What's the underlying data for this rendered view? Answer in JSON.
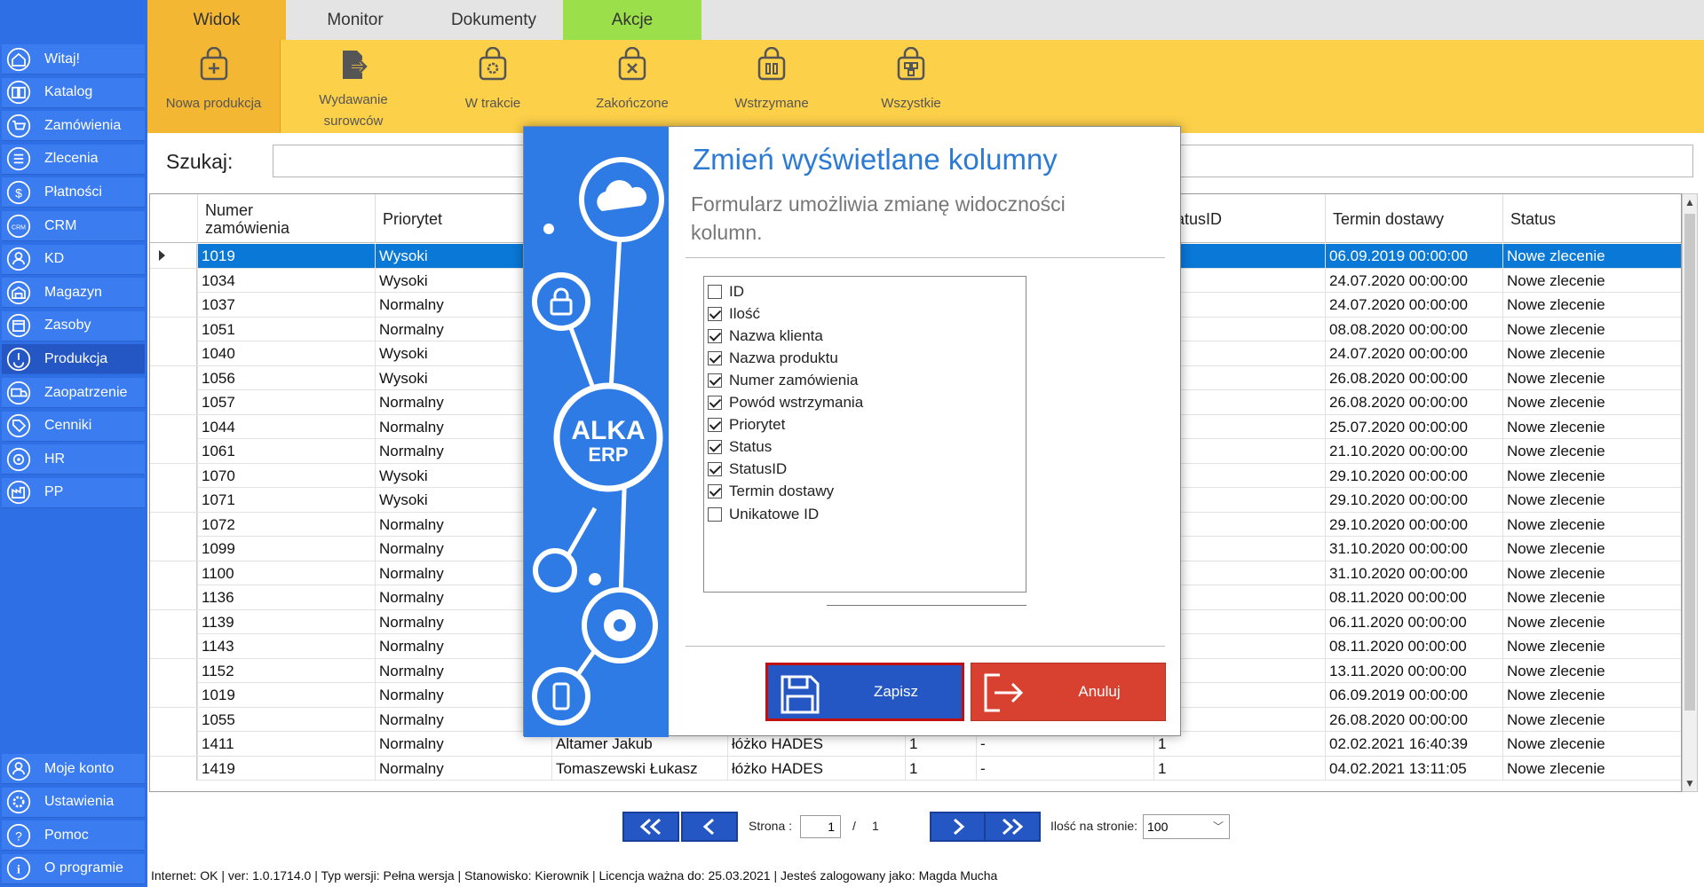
{
  "colors": {
    "sidebar": "#2f6fe6",
    "ribbon": "#fdd04a",
    "ribbon_selected": "#f4b733",
    "tab_akcje": "#9be04a",
    "tab_widok": "#f4b733",
    "selected_row": "#0a78d7",
    "save": "#2456c4",
    "cancel": "#d8412f"
  },
  "sidebar": {
    "items": [
      {
        "label": "Witaj!",
        "icon": "home-icon"
      },
      {
        "label": "Katalog",
        "icon": "book-icon"
      },
      {
        "label": "Zamówienia",
        "icon": "cart-icon"
      },
      {
        "label": "Zlecenia",
        "icon": "list-icon"
      },
      {
        "label": "Płatności",
        "icon": "dollar-icon"
      },
      {
        "label": "CRM",
        "icon": "crm-icon"
      },
      {
        "label": "KD",
        "icon": "person-icon"
      },
      {
        "label": "Magazyn",
        "icon": "warehouse-icon"
      },
      {
        "label": "Zasoby",
        "icon": "calendar-icon"
      },
      {
        "label": "Produkcja",
        "icon": "production-icon"
      },
      {
        "label": "Zaopatrzenie",
        "icon": "truck-icon"
      },
      {
        "label": "Cenniki",
        "icon": "tag-icon"
      },
      {
        "label": "HR",
        "icon": "hr-icon"
      },
      {
        "label": "PP",
        "icon": "factory-icon"
      }
    ],
    "bottom": [
      {
        "label": "Moje konto",
        "icon": "user-icon"
      },
      {
        "label": "Ustawienia",
        "icon": "gear-icon"
      },
      {
        "label": "Pomoc",
        "icon": "help-icon"
      },
      {
        "label": "O programie",
        "icon": "info-icon"
      }
    ]
  },
  "tabs": [
    {
      "label": "Widok"
    },
    {
      "label": "Monitor"
    },
    {
      "label": "Dokumenty"
    },
    {
      "label": "Akcje"
    }
  ],
  "ribbon": {
    "buttons": [
      {
        "label": "Nowa produkcja"
      },
      {
        "label": "Wydawanie",
        "label2": "surowców"
      },
      {
        "label": "W trakcie"
      },
      {
        "label": "Zakończone"
      },
      {
        "label": "Wstrzymane"
      },
      {
        "label": "Wszystkie"
      }
    ]
  },
  "search": {
    "label": "Szukaj:",
    "value": ""
  },
  "grid": {
    "headers": {
      "numer1": "Numer",
      "numer2": "zamówienia",
      "priorytet": "Priorytet",
      "statusid": "atusID",
      "termin": "Termin dostawy",
      "status": "Status"
    },
    "rows": [
      {
        "numer": "1019",
        "priorytet": "Wysoki",
        "termin": "06.09.2019 00:00:00",
        "status": "Nowe zlecenie"
      },
      {
        "numer": "1034",
        "priorytet": "Wysoki",
        "termin": "24.07.2020 00:00:00",
        "status": "Nowe zlecenie"
      },
      {
        "numer": "1037",
        "priorytet": "Normalny",
        "termin": "24.07.2020 00:00:00",
        "status": "Nowe zlecenie"
      },
      {
        "numer": "1051",
        "priorytet": "Normalny",
        "termin": "08.08.2020 00:00:00",
        "status": "Nowe zlecenie"
      },
      {
        "numer": "1040",
        "priorytet": "Wysoki",
        "termin": "24.07.2020 00:00:00",
        "status": "Nowe zlecenie"
      },
      {
        "numer": "1056",
        "priorytet": "Wysoki",
        "termin": "26.08.2020 00:00:00",
        "status": "Nowe zlecenie"
      },
      {
        "numer": "1057",
        "priorytet": "Normalny",
        "termin": "26.08.2020 00:00:00",
        "status": "Nowe zlecenie"
      },
      {
        "numer": "1044",
        "priorytet": "Normalny",
        "termin": "25.07.2020 00:00:00",
        "status": "Nowe zlecenie"
      },
      {
        "numer": "1061",
        "priorytet": "Normalny",
        "termin": "21.10.2020 00:00:00",
        "status": "Nowe zlecenie"
      },
      {
        "numer": "1070",
        "priorytet": "Wysoki",
        "termin": "29.10.2020 00:00:00",
        "status": "Nowe zlecenie"
      },
      {
        "numer": "1071",
        "priorytet": "Wysoki",
        "termin": "29.10.2020 00:00:00",
        "status": "Nowe zlecenie"
      },
      {
        "numer": "1072",
        "priorytet": "Normalny",
        "termin": "29.10.2020 00:00:00",
        "status": "Nowe zlecenie"
      },
      {
        "numer": "1099",
        "priorytet": "Normalny",
        "termin": "31.10.2020 00:00:00",
        "status": "Nowe zlecenie"
      },
      {
        "numer": "1100",
        "priorytet": "Normalny",
        "termin": "31.10.2020 00:00:00",
        "status": "Nowe zlecenie"
      },
      {
        "numer": "1136",
        "priorytet": "Normalny",
        "termin": "08.11.2020 00:00:00",
        "status": "Nowe zlecenie"
      },
      {
        "numer": "1139",
        "priorytet": "Normalny",
        "termin": "06.11.2020 00:00:00",
        "status": "Nowe zlecenie"
      },
      {
        "numer": "1143",
        "priorytet": "Normalny",
        "termin": "08.11.2020 00:00:00",
        "status": "Nowe zlecenie"
      },
      {
        "numer": "1152",
        "priorytet": "Normalny",
        "termin": "13.11.2020 00:00:00",
        "status": "Nowe zlecenie"
      },
      {
        "numer": "1019",
        "priorytet": "Normalny",
        "termin": "06.09.2019 00:00:00",
        "status": "Nowe zlecenie"
      },
      {
        "numer": "1055",
        "priorytet": "Normalny",
        "termin": "26.08.2020 00:00:00",
        "status": "Nowe zlecenie"
      },
      {
        "numer": "1411",
        "priorytet": "Normalny",
        "klient": "Altamer Jakub",
        "produkt": "łóżko HADES",
        "ilosc": "1",
        "powod": "-",
        "statusid": "1",
        "termin": "02.02.2021 16:40:39",
        "status": "Nowe zlecenie"
      },
      {
        "numer": "1419",
        "priorytet": "Normalny",
        "klient": "Tomaszewski Łukasz",
        "produkt": "łóżko HADES",
        "ilosc": "1",
        "powod": "-",
        "statusid": "1",
        "termin": "04.02.2021 13:11:05",
        "status": "Nowe zlecenie"
      }
    ]
  },
  "pager": {
    "page_label": "Strona :",
    "page": "1",
    "sep": "/",
    "total": "1",
    "per_page_label": "Ilość na stronie:",
    "per_page": "100"
  },
  "status_bar": "Internet: OK  |  ver: 1.0.1714.0  |  Typ wersji: Pełna wersja  |  Stanowisko: Kierownik  |  Licencja ważna do: 25.03.2021  |  Jesteś zalogowany jako: Magda Mucha",
  "dialog": {
    "title": "Zmień wyświetlane kolumny",
    "subtitle": "Formularz umożliwia zmianę widoczności kolumn.",
    "logo_text": "ALKA ERP",
    "columns": [
      {
        "label": "ID",
        "checked": false
      },
      {
        "label": "Ilość",
        "checked": true
      },
      {
        "label": "Nazwa klienta",
        "checked": true
      },
      {
        "label": "Nazwa produktu",
        "checked": true
      },
      {
        "label": "Numer zamówienia",
        "checked": true
      },
      {
        "label": "Powód wstrzymania",
        "checked": true
      },
      {
        "label": "Priorytet",
        "checked": true
      },
      {
        "label": "Status",
        "checked": true
      },
      {
        "label": "StatusID",
        "checked": true
      },
      {
        "label": "Termin dostawy",
        "checked": true
      },
      {
        "label": "Unikatowe ID",
        "checked": false
      }
    ],
    "save_label": "Zapisz",
    "cancel_label": "Anuluj"
  }
}
